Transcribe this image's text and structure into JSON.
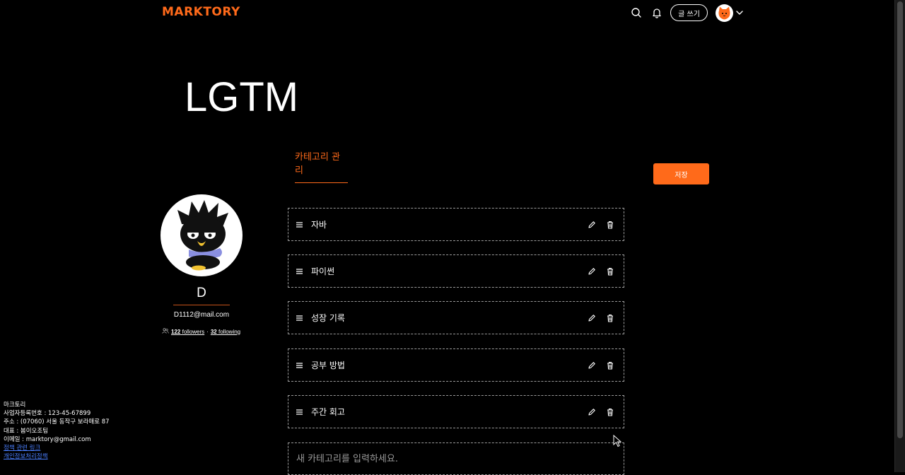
{
  "header": {
    "logo": "MARKTORY",
    "write_label": "글 쓰기",
    "icons": [
      "search-icon",
      "bell-icon",
      "avatar-cat-icon",
      "chevron-down-icon"
    ],
    "accent_color": "#ff6a1a"
  },
  "blog": {
    "title": "LGTM"
  },
  "tabs": {
    "category_manage": "카테고리 관리"
  },
  "actions": {
    "save_label": "저장"
  },
  "profile": {
    "name": "D",
    "email": "D1112@mail.com",
    "followers_count": "122",
    "followers_label": "followers",
    "separator": "·",
    "following_count": "32",
    "following_label": "following"
  },
  "categories": [
    {
      "label": "자바"
    },
    {
      "label": "파이썬"
    },
    {
      "label": "성장 기록"
    },
    {
      "label": "공부 방법"
    },
    {
      "label": "주간 회고"
    }
  ],
  "new_category": {
    "placeholder": "새 카테고리를 입력하세요."
  },
  "footer": {
    "company": "마크토리",
    "business_no": "사업자등록번호 : 123-45-67899",
    "address": "주소 : (07060) 서울 동작구 보라매로 87",
    "ceo": "대표 : 봄이오조팀",
    "email": "이메일 : marktory@gmail.com",
    "policy_link": "정책 관련 링크",
    "privacy_link": "개인정보처리정책"
  }
}
